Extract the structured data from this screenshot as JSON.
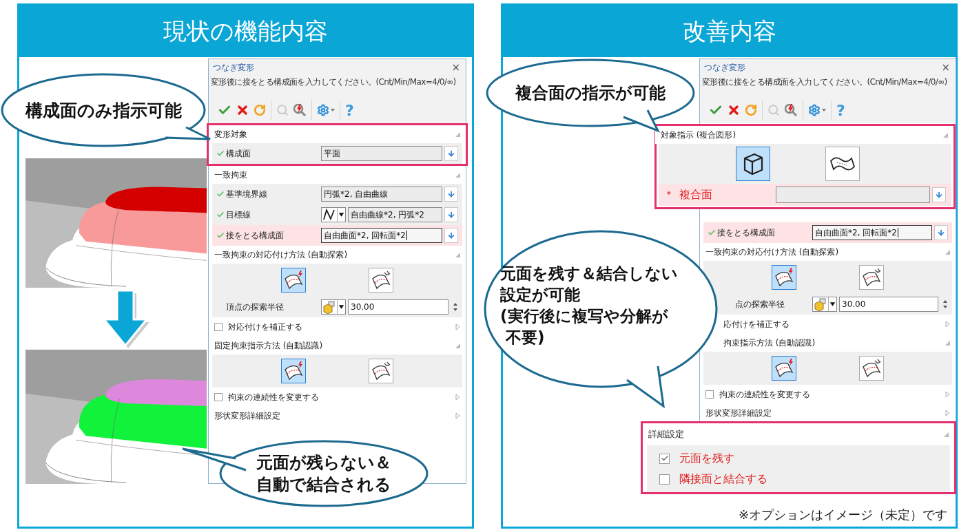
{
  "left_panel": {
    "title": "現状の機能内容",
    "callouts": [
      {
        "lines": [
          "構成面のみ指示可能"
        ]
      },
      {
        "lines": [
          "元面が残らない＆",
          "自動で結合される"
        ]
      }
    ],
    "dialog": {
      "title": "つなぎ変形",
      "close": "×",
      "prompt": "変形後に接をとる構成面を入力してください。(Cnt/Min/Max=4/0/∞)",
      "toolbar": [
        [
          {
            "kind": "ok",
            "disabled": false
          },
          {
            "kind": "cancel",
            "disabled": false
          },
          {
            "kind": "redo",
            "disabled": false
          }
        ],
        [
          {
            "kind": "zoom",
            "disabled": true
          },
          {
            "kind": "zoom-pick",
            "disabled": false
          }
        ],
        [
          {
            "kind": "settings",
            "disabled": false
          }
        ],
        [
          {
            "kind": "help",
            "label": "?",
            "disabled": false
          }
        ]
      ],
      "groups": [
        {
          "outlined": true,
          "items": [
            {
              "kind": "header",
              "label": "変形対象",
              "expanded": true
            },
            {
              "kind": "field",
              "label": "構成面",
              "valid": true,
              "highlighted": false,
              "value": "平面",
              "focused": false
            }
          ]
        },
        {
          "outlined": false,
          "items": [
            {
              "kind": "header",
              "label": "一致拘束",
              "expanded": true
            },
            {
              "kind": "field",
              "label": "基準境界線",
              "valid": true,
              "highlighted": false,
              "value": "円弧*2, 自由曲線",
              "focused": false
            },
            {
              "kind": "picker-field",
              "label": "目標線",
              "valid": true,
              "highlighted": false,
              "value": "自由曲線*2, 円弧*2",
              "focused": false
            },
            {
              "kind": "field",
              "label": "接をとる構成面",
              "valid": true,
              "highlighted": true,
              "value": "自由曲面*2, 回転面*2",
              "focused": true
            },
            {
              "kind": "header",
              "label": "一致拘束の対応付け方法 (自動探索)",
              "expanded": true
            },
            {
              "kind": "choice",
              "options": [
                {
                  "selected": true
                },
                {
                  "selected": false
                }
              ]
            },
            {
              "kind": "number-field",
              "label": "頂点の探索半径",
              "valid": false,
              "highlighted": false,
              "value": "30.00",
              "focused": false
            },
            {
              "kind": "checkbox",
              "label": "対応付けを補正する",
              "checked": false,
              "expanded": false
            },
            {
              "kind": "header",
              "label": "固定拘束指示方法 (自動認識)",
              "expanded": true
            },
            {
              "kind": "choice",
              "options": [
                {
                  "selected": true
                },
                {
                  "selected": false
                }
              ]
            },
            {
              "kind": "checkbox",
              "label": "拘束の連続性を変更する",
              "checked": false,
              "expanded": false
            },
            {
              "kind": "header",
              "label": "形状変形詳細設定",
              "expanded": false
            }
          ]
        }
      ]
    }
  },
  "right_panel": {
    "title": "改善内容",
    "callouts": [
      {
        "lines": [
          "複合面の指示が可能"
        ]
      },
      {
        "lines": [
          "元面を残す＆結合しない",
          "設定が可能",
          "(実行後に複写や分解が",
          " 不要)"
        ]
      }
    ],
    "dialog": {
      "title": "つなぎ変形",
      "close": "×",
      "prompt": "変形後に接をとる構成面を入力してください。(Cnt/Min/Max=4/0/∞)",
      "toolbar": [
        [
          {
            "kind": "ok",
            "disabled": false
          },
          {
            "kind": "cancel",
            "disabled": false
          },
          {
            "kind": "redo",
            "disabled": false
          }
        ],
        [
          {
            "kind": "zoom",
            "disabled": true
          },
          {
            "kind": "zoom-pick",
            "disabled": false
          }
        ],
        [
          {
            "kind": "settings",
            "disabled": false
          }
        ],
        [
          {
            "kind": "help",
            "label": "?",
            "disabled": false
          }
        ]
      ],
      "groups": [
        {
          "outlined": false,
          "items": [
            {
              "kind": "field",
              "label": "接をとる構成面",
              "valid": true,
              "highlighted": true,
              "value": "自由曲面*2, 回転面*2",
              "focused": true
            },
            {
              "kind": "header",
              "label": "一致拘束の対応付け方法 (自動探索)",
              "expanded": true
            },
            {
              "kind": "choice",
              "options": [
                {
                  "selected": true
                },
                {
                  "selected": false
                }
              ]
            },
            {
              "kind": "number-field",
              "label": "点の探索半径",
              "valid": false,
              "highlighted": false,
              "value": "30.00",
              "focused": false
            },
            {
              "kind": "label-row",
              "label": "応付けを補正する",
              "expanded": false
            },
            {
              "kind": "header",
              "label": "拘束指示方法 (自動認識)",
              "expanded": true
            },
            {
              "kind": "choice",
              "options": [
                {
                  "selected": true
                },
                {
                  "selected": false
                }
              ]
            },
            {
              "kind": "checkbox",
              "label": "拘束の連続性を変更する",
              "checked": false,
              "expanded": false
            },
            {
              "kind": "header",
              "label": "形状変形詳細設定",
              "expanded": false
            }
          ]
        }
      ]
    },
    "target_box": {
      "title": "対象指示 (複合図形)",
      "expanded": true,
      "options": [
        {
          "selected": true
        },
        {
          "selected": false
        }
      ],
      "field": {
        "mark": "＊",
        "label": "複合面"
      }
    },
    "detail_box": {
      "title": "詳細設定",
      "expanded": true,
      "options": [
        {
          "label": "元面を残す",
          "checked": true
        },
        {
          "label": "隣接面と結合する",
          "checked": false
        }
      ]
    },
    "note": "※オプションはイメージ（未定）です"
  }
}
